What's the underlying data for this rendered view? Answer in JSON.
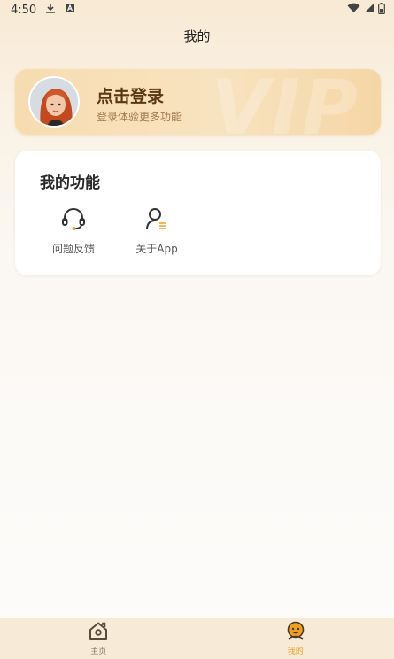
{
  "status_bar": {
    "time": "4:50",
    "icons": [
      "download-icon",
      "notification-a-icon",
      "wifi-icon",
      "signal-icon",
      "battery-icon"
    ]
  },
  "header": {
    "title": "我的"
  },
  "login_card": {
    "title": "点击登录",
    "subtitle": "登录体验更多功能",
    "watermark": "VIP"
  },
  "functions": {
    "title": "我的功能",
    "items": [
      {
        "label": "问题反馈",
        "icon": "headset-icon"
      },
      {
        "label": "关于App",
        "icon": "user-info-icon"
      }
    ]
  },
  "tab_bar": {
    "items": [
      {
        "label": "主页",
        "icon": "home-icon",
        "active": false
      },
      {
        "label": "我的",
        "icon": "profile-face-icon",
        "active": true
      }
    ]
  },
  "colors": {
    "accent": "#f0a020",
    "card_gradient_start": "#f7dcb0",
    "login_title": "#5a3814",
    "tab_bar_bg": "#f7ead7"
  }
}
